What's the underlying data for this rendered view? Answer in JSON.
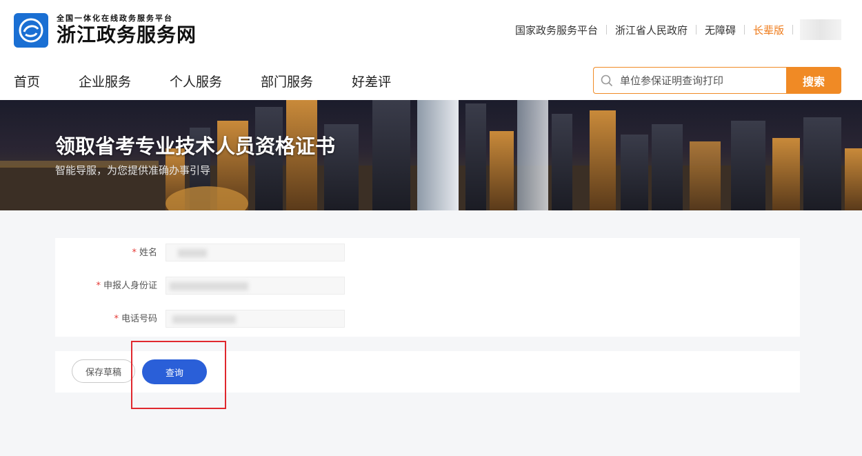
{
  "header": {
    "logo_sub": "全国一体化在线政务服务平台",
    "logo_main": "浙江政务服务网",
    "top_links": [
      "国家政务服务平台",
      "浙江省人民政府",
      "无障碍"
    ],
    "elder_mode": "长辈版"
  },
  "nav": {
    "items": [
      "首页",
      "企业服务",
      "个人服务",
      "部门服务",
      "好差评"
    ]
  },
  "search": {
    "placeholder": "单位参保证明查询打印",
    "button": "搜索"
  },
  "banner": {
    "title": "领取省考专业技术人员资格证书",
    "subtitle": "智能导服，为您提供准确办事引导"
  },
  "form": {
    "required_mark": "*",
    "fields": [
      {
        "label": "姓名",
        "value": ""
      },
      {
        "label": "申报人身份证",
        "value": ""
      },
      {
        "label": "电话号码",
        "value": ""
      }
    ]
  },
  "actions": {
    "save_draft": "保存草稿",
    "query": "查询"
  },
  "colors": {
    "accent_orange": "#f08a25",
    "primary_blue": "#2a5fd8",
    "highlight_red": "#e0272d",
    "logo_blue": "#1a6fd3"
  }
}
